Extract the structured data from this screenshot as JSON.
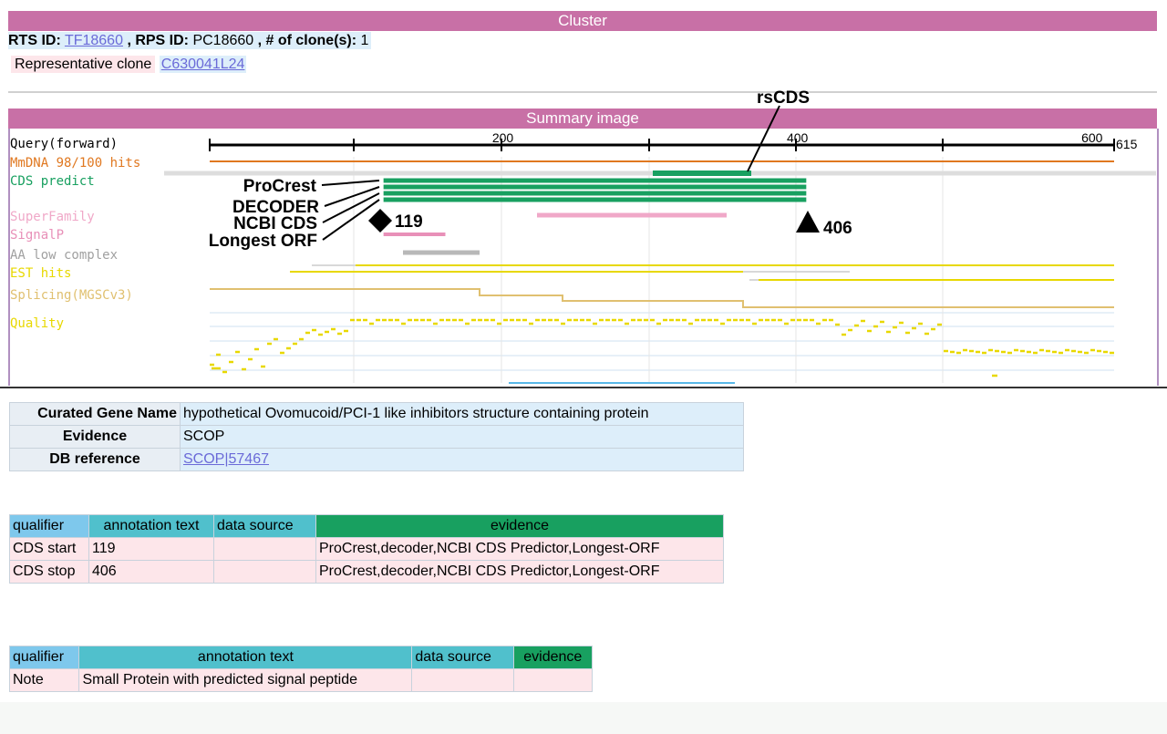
{
  "cluster": {
    "title": "Cluster",
    "rts_label": "RTS ID:",
    "rts_id": "TF18660",
    "rps_label": ", RPS ID:",
    "rps_id": "PC18660",
    "clones_label": ", # of clone(s):",
    "clones": "1",
    "rep_label": "Representative clone",
    "rep_clone": "C630041L24"
  },
  "summary": {
    "title": "Summary image",
    "tracks": [
      {
        "label": "Query(forward)",
        "color": "#000000"
      },
      {
        "label": "MmDNA 98/100 hits",
        "color": "#e07820"
      },
      {
        "label": "CDS predict",
        "color": "#18a060"
      },
      {
        "label": "SuperFamily",
        "color": "#f0a8c8"
      },
      {
        "label": "SignalP",
        "color": "#e890b8"
      },
      {
        "label": "AA low complex",
        "color": "#a0a0a0"
      },
      {
        "label": "EST hits",
        "color": "#e8d800"
      },
      {
        "label": "Splicing(MGSCv3)",
        "color": "#e0c070"
      },
      {
        "label": "Quality",
        "color": "#e8d800"
      }
    ],
    "axis": {
      "min": 1,
      "max": 615,
      "ticks": [
        "200",
        "400",
        "600"
      ],
      "end_label": "615"
    },
    "annotations": {
      "rscds": "rsCDS",
      "procrest": "ProCrest",
      "decoder": "DECODER",
      "ncbi": "NCBI CDS",
      "longest": "Longest ORF",
      "start": "119",
      "stop": "406"
    }
  },
  "gene": {
    "rows": [
      {
        "key": "Curated Gene Name",
        "value": "hypothetical Ovomucoid/PCI-1 like inhibitors structure containing protein",
        "link": false
      },
      {
        "key": "Evidence",
        "value": "SCOP",
        "link": false
      },
      {
        "key": "DB reference",
        "value": "SCOP|57467",
        "link": true
      }
    ]
  },
  "qual1": {
    "headers": [
      "qualifier",
      "annotation text",
      "data source",
      "evidence"
    ],
    "rows": [
      [
        "CDS start",
        "119",
        "",
        "ProCrest,decoder,NCBI CDS Predictor,Longest-ORF"
      ],
      [
        "CDS stop",
        "406",
        "",
        "ProCrest,decoder,NCBI CDS Predictor,Longest-ORF"
      ]
    ]
  },
  "qual2": {
    "headers": [
      "qualifier",
      "annotation text",
      "data source",
      "evidence"
    ],
    "rows": [
      [
        "Note",
        "Small Protein with predicted signal peptide",
        "",
        ""
      ]
    ]
  },
  "colors": {
    "header_pink": "#c870a6",
    "q_blue": "#7ec8ec",
    "q_teal": "#50c0cc",
    "q_green": "#18a060",
    "row_pink": "#fde6ea",
    "gene_blue": "#ddeefa"
  }
}
